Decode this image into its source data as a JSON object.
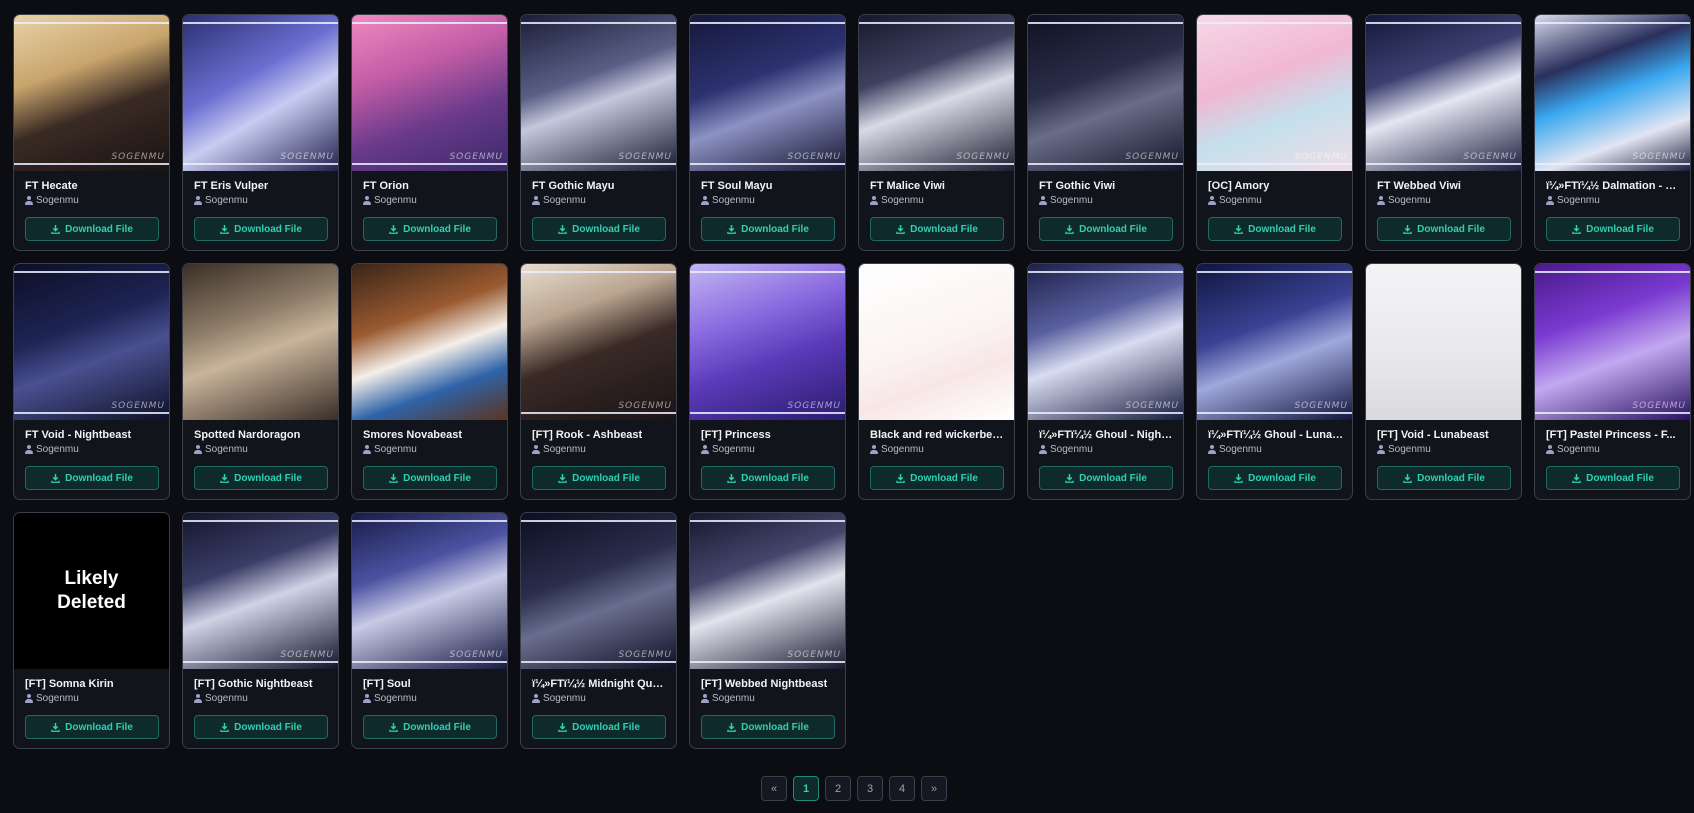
{
  "cards": [
    {
      "title": "FT Hecate",
      "author": "Sogenmu",
      "button": "Download File",
      "watermark": "SOGENMU",
      "bg": "linear-gradient(160deg,#e8d2a8 0%,#c9a56c 35%,#3a2a24 60%,#1a1312 100%)"
    },
    {
      "title": "FT Eris Vulper",
      "author": "Sogenmu",
      "button": "Download File",
      "watermark": "SOGENMU",
      "bg": "linear-gradient(150deg,#2b2f6e 0%,#6b6ed0 40%,#c9ccf2 60%,#20224e 100%)"
    },
    {
      "title": "FT Orion",
      "author": "Sogenmu",
      "button": "Download File",
      "watermark": "SOGENMU",
      "bg": "linear-gradient(160deg,#f08ac0 0%,#c25ca6 35%,#6a3a8a 65%,#3a2a6a 100%)"
    },
    {
      "title": "FT Gothic Mayu",
      "author": "Sogenmu",
      "button": "Download File",
      "watermark": "SOGENMU",
      "bg": "linear-gradient(160deg,#1b1e38 0%,#5a5f86 40%,#c5c8dc 55%,#171a30 100%)"
    },
    {
      "title": "FT Soul Mayu",
      "author": "Sogenmu",
      "button": "Download File",
      "watermark": "SOGENMU",
      "bg": "linear-gradient(160deg,#14183a 0%,#2d3270 40%,#8d92c4 60%,#12152e 100%)"
    },
    {
      "title": "FT Malice Viwi",
      "author": "Sogenmu",
      "button": "Download File",
      "watermark": "SOGENMU",
      "bg": "linear-gradient(160deg,#16182c 0%,#3e4260 35%,#d8dae6 55%,#1b1d30 100%)"
    },
    {
      "title": "FT Gothic Viwi",
      "author": "Sogenmu",
      "button": "Download File",
      "watermark": "SOGENMU",
      "bg": "linear-gradient(160deg,#0f1122 0%,#2a2d48 40%,#6a6d88 60%,#121428 100%)"
    },
    {
      "title": "[OC]   Amory",
      "author": "Sogenmu",
      "button": "Download File",
      "watermark": "SOGENMU",
      "bg": "linear-gradient(160deg,#f6d8e6 0%,#f0b8d2 40%,#c4e0ec 65%,#f0dce6 100%)"
    },
    {
      "title": "FT Webbed Viwi",
      "author": "Sogenmu",
      "button": "Download File",
      "watermark": "SOGENMU",
      "bg": "linear-gradient(160deg,#15183a 0%,#3c4070 35%,#e4e6f2 55%,#1b1e3e 100%)"
    },
    {
      "title": "ï¼»FTï¼½ Dalmation - Ke...",
      "author": "Sogenmu",
      "button": "Download File",
      "watermark": "SOGENMU",
      "bg": "linear-gradient(160deg,#d9ddee 0%,#2a2f5c 30%,#3aa8f0 50%,#e2e5f2 75%,#1a1e3a 100%)"
    },
    {
      "title": "FT Void - Nightbeast",
      "author": "Sogenmu",
      "button": "Download File",
      "watermark": "SOGENMU",
      "bg": "linear-gradient(160deg,#0c0f26 0%,#1e2454 40%,#4a5090 60%,#0e1128 100%)"
    },
    {
      "title": "Spotted Nardoragon",
      "author": "Sogenmu",
      "button": "Download File",
      "watermark": "",
      "bg": "linear-gradient(160deg,#3a2e26 0%,#8a7a66 35%,#c8b49a 55%,#3a2e28 100%)"
    },
    {
      "title": "Smores Novabeast",
      "author": "Sogenmu",
      "button": "Download File",
      "watermark": "",
      "bg": "linear-gradient(160deg,#3a2418 0%,#9a5a30 35%,#f4efe8 55%,#2f63a8 75%,#5a3420 100%)"
    },
    {
      "title": "[FT]   Rook - Ashbeast",
      "author": "Sogenmu",
      "button": "Download File",
      "watermark": "SOGENMU",
      "bg": "linear-gradient(160deg,#e8ddd0 0%,#b9a590 30%,#3a2a26 55%,#1a1416 100%)"
    },
    {
      "title": "[FT]   Princess",
      "author": "Sogenmu",
      "button": "Download File",
      "watermark": "SOGENMU",
      "bg": "linear-gradient(160deg,#c2b6f4 0%,#8a6ae0 35%,#5a3ab8 60%,#2a1c6e 100%)"
    },
    {
      "title": "Black and red wickerbeast",
      "author": "Sogenmu",
      "button": "Download File",
      "watermark": "",
      "bg": "linear-gradient(160deg,#ffffff 0%,#fbf3f3 50%,#f8e6e6 70%,#ffffff 100%)"
    },
    {
      "title": "ï¼»FTï¼½ Ghoul - Nightb...",
      "author": "Sogenmu",
      "button": "Download File",
      "watermark": "SOGENMU",
      "bg": "linear-gradient(160deg,#1c2048 0%,#5a60a0 35%,#d8dcf0 55%,#181c40 100%)"
    },
    {
      "title": "ï¼»FTï¼½ Ghoul - Lunabe...",
      "author": "Sogenmu",
      "button": "Download File",
      "watermark": "SOGENMU",
      "bg": "linear-gradient(160deg,#101640 0%,#3a4294 40%,#a0a8dc 60%,#121640 100%)"
    },
    {
      "title": "[FT]   Void - Lunabeast",
      "author": "Sogenmu",
      "button": "Download File",
      "watermark": "",
      "bg": "linear-gradient(180deg,#f4f4f6 0%,#e8e8ec 60%,#dadade 100%)"
    },
    {
      "title": "[FT]   Pastel Princess - F...",
      "author": "Sogenmu",
      "button": "Download File",
      "watermark": "SOGENMU",
      "bg": "linear-gradient(160deg,#4a1a8a 0%,#7a3ad0 35%,#c2a8f0 60%,#2a1260 100%)"
    },
    {
      "title": "[FT]   Somna Kirin",
      "author": "Sogenmu",
      "button": "Download File",
      "watermark": "",
      "deleted": "Likely\nDeleted",
      "bg": ""
    },
    {
      "title": "[FT]   Gothic Nightbeast",
      "author": "Sogenmu",
      "button": "Download File",
      "watermark": "SOGENMU",
      "bg": "linear-gradient(160deg,#14162e 0%,#3a3d66 35%,#d0d2e6 55%,#12142a 100%)"
    },
    {
      "title": "[FT]   Soul",
      "author": "Sogenmu",
      "button": "Download File",
      "watermark": "SOGENMU",
      "bg": "linear-gradient(160deg,#181c4a 0%,#4c52a0 35%,#c8cae6 55%,#161a40 100%)"
    },
    {
      "title": "ï¼»FTï¼½ Midnight Quee...",
      "author": "Sogenmu",
      "button": "Download File",
      "watermark": "SOGENMU",
      "bg": "linear-gradient(160deg,#0c0e20 0%,#2a2e4c 40%,#6a6e8e 60%,#0e1024 100%)"
    },
    {
      "title": "[FT]   Webbed Nightbeast",
      "author": "Sogenmu",
      "button": "Download File",
      "watermark": "SOGENMU",
      "bg": "linear-gradient(160deg,#16182e 0%,#44476c 35%,#e2e3ee 55%,#15172c 100%)"
    }
  ],
  "pagination": {
    "prev": "«",
    "pages": [
      "1",
      "2",
      "3",
      "4"
    ],
    "active_page": "1",
    "next": "»"
  },
  "colors": {
    "accent": "#2fd0b4",
    "background": "#0b0d12",
    "card": "#11141b"
  }
}
